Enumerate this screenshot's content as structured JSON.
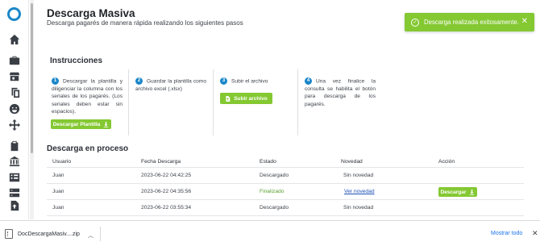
{
  "header": {
    "title": "Descarga Masiva",
    "subtitle": "Descarga pagarés de manera rápida realizando los siguientes pasos"
  },
  "toast": {
    "message": "Descarga realizada exitosamente.",
    "close": "✕",
    "color": "#84c832"
  },
  "instructions": {
    "title": "Instrucciones",
    "steps": [
      {
        "number": "1",
        "text": "Descargar la plantilla y diligenciar la columna con los seriales de los pagarés. (Los seriales deben estar sin espacios).",
        "button": "Descargar Plantilla"
      },
      {
        "number": "2",
        "text": "Guardar la plantilla como archivo excel (.xlsx)"
      },
      {
        "number": "3",
        "text": "Subir el archivo",
        "button": "Subir archivo"
      },
      {
        "number": "4",
        "text": "Una vez finalice la consulta se habilita el botón para descarga de los pagarés."
      }
    ]
  },
  "downloads": {
    "title": "Descarga en proceso",
    "columns": [
      "Usuario",
      "Fecha Descarga",
      "Estado",
      "Novedad",
      "Acción"
    ],
    "rows": [
      {
        "usuario": "Juan",
        "fecha": "2023-06-22 04:42:25",
        "estado": "Descargado",
        "novedad": "Sin novedad",
        "accion": ""
      },
      {
        "usuario": "Juan",
        "fecha": "2023-06-22 04:35:56",
        "estado": "Finalizado",
        "novedad": "Ver novedad",
        "accion": "Descargar"
      },
      {
        "usuario": "Juan",
        "fecha": "2023-06-22 03:55:34",
        "estado": "Descargado",
        "novedad": "Sin novedad",
        "accion": ""
      }
    ]
  },
  "download_bar": {
    "file_name": "DocDescargaMasiv....zip",
    "show_all": "Mostrar todo",
    "close": "✕"
  },
  "sidebar": {
    "icons": [
      "home-icon",
      "briefcase-icon",
      "store-icon",
      "copy-icon",
      "emoji-icon",
      "move-icon",
      "clipboard-icon",
      "bank-icon",
      "checklist-icon",
      "server-icon",
      "upload-file-icon"
    ]
  },
  "colors": {
    "accent": "#1a87c9",
    "success": "#84c832",
    "link": "#1a4fb5"
  }
}
